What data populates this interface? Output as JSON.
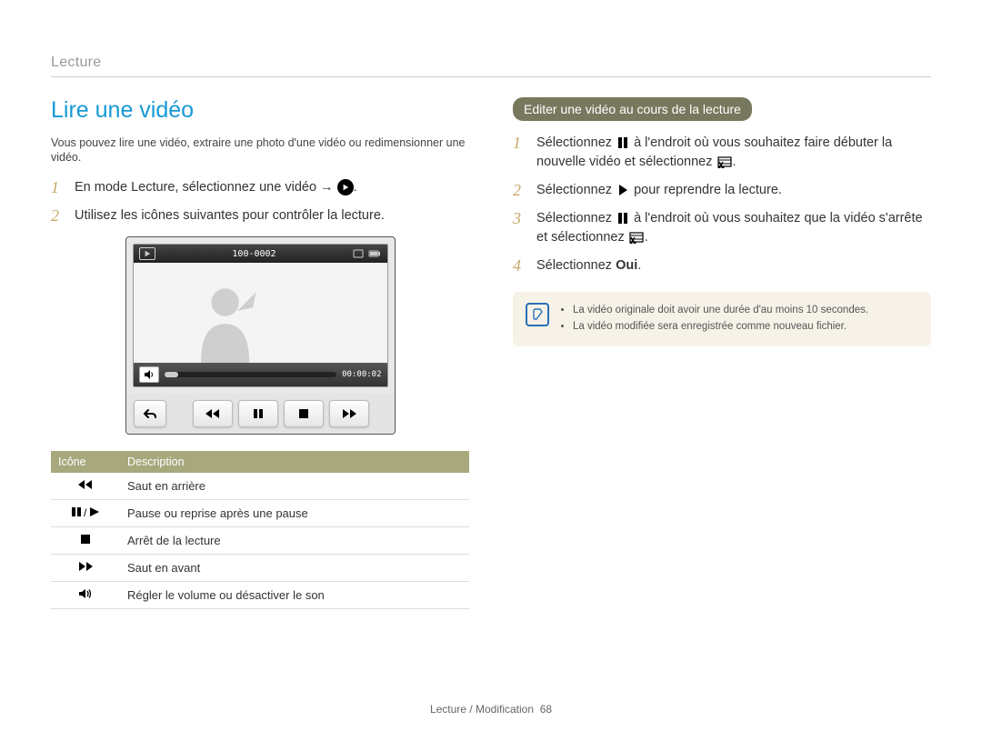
{
  "header": "Lecture",
  "footer": {
    "text": "Lecture / Modification",
    "page": "68"
  },
  "left": {
    "heading": "Lire une vidéo",
    "intro": "Vous pouvez lire une vidéo, extraire une photo d'une vidéo ou redimensionner une vidéo.",
    "step1_a": "En mode Lecture, sélectionnez une vidéo → ",
    "step1_b": ".",
    "step2": "Utilisez les icônes suivantes pour contrôler la lecture.",
    "cam": {
      "file": "100-0002",
      "time": "00:00:02"
    },
    "table": {
      "hdr_icon": "Icône",
      "hdr_desc": "Description",
      "rows": [
        {
          "desc": "Saut en arrière"
        },
        {
          "desc": "Pause ou reprise après une pause"
        },
        {
          "desc": "Arrêt de la lecture"
        },
        {
          "desc": "Saut en avant"
        },
        {
          "desc": "Régler le volume ou désactiver le son"
        }
      ]
    }
  },
  "right": {
    "pill": "Editer une vidéo au cours de la lecture",
    "step1_a": "Sélectionnez ",
    "step1_b": " à l'endroit où vous souhaitez faire débuter la nouvelle vidéo et sélectionnez ",
    "step1_c": ".",
    "step2_a": "Sélectionnez ",
    "step2_b": " pour reprendre la lecture.",
    "step3_a": "Sélectionnez ",
    "step3_b": " à l'endroit où vous souhaitez que la vidéo s'arrête et sélectionnez ",
    "step3_c": ".",
    "step4_a": "Sélectionnez ",
    "step4_b": "Oui",
    "step4_c": ".",
    "notes": [
      "La vidéo originale doit avoir une durée d'au moins 10 secondes.",
      "La vidéo modifiée sera enregistrée comme nouveau fichier."
    ]
  }
}
